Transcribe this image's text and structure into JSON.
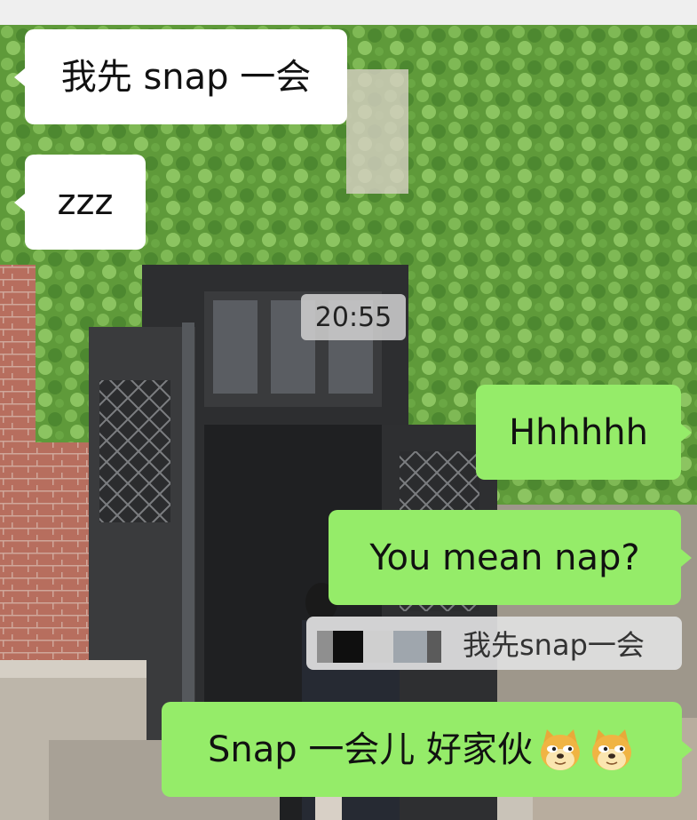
{
  "chat": {
    "timestamp": "20:55",
    "messages": [
      {
        "side": "in",
        "text": "我先 snap 一会"
      },
      {
        "side": "in",
        "text": "zzz"
      },
      {
        "side": "out",
        "text": "Hhhhhh"
      },
      {
        "side": "out",
        "text": "You mean nap?"
      },
      {
        "side": "out",
        "text": "Snap 一会儿 好家伙",
        "emojis": [
          "doge-emoji",
          "doge-emoji"
        ]
      }
    ],
    "quote": {
      "text": "我先snap一会",
      "sender_redacted": true
    }
  },
  "colors": {
    "incoming_bubble": "#ffffff",
    "outgoing_bubble": "#95ec69",
    "timestamp_bg": "#cdcdcd",
    "quote_bg": "#e1e1e1"
  }
}
